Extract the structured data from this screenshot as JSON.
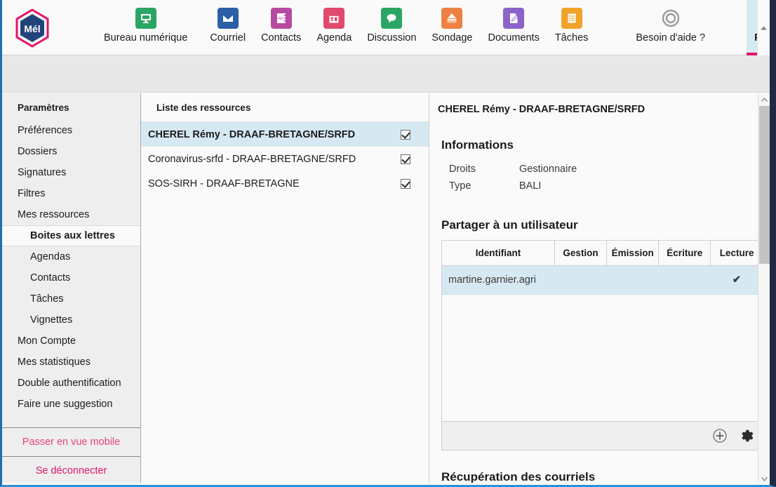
{
  "app": {
    "logo_text": "Mél",
    "accent_pink": "#e5136a",
    "accent_blue": "#d6e9f2",
    "check_green": "#6c9c33"
  },
  "toolbar": {
    "items": [
      {
        "label": "Bureau numérique",
        "icon": "monitor-icon",
        "color": "#2aa563",
        "active": false
      },
      {
        "label": "Courriel",
        "icon": "envelope-icon",
        "color": "#2c5fa8",
        "active": false
      },
      {
        "label": "Contacts",
        "icon": "addressbook-icon",
        "color": "#b64aa0",
        "active": false
      },
      {
        "label": "Agenda",
        "icon": "calendar-icon",
        "color": "#e04a6e",
        "active": false
      },
      {
        "label": "Discussion",
        "icon": "chat-bubble-icon",
        "color": "#2aa563",
        "active": false
      },
      {
        "label": "Sondage",
        "icon": "ballot-box-icon",
        "color": "#ef8043",
        "active": false
      },
      {
        "label": "Documents",
        "icon": "document-edit-icon",
        "color": "#8b63c9",
        "active": false
      },
      {
        "label": "Tâches",
        "icon": "tasklist-icon",
        "color": "#f0a32a",
        "active": false
      },
      {
        "label": "Besoin d'aide ?",
        "icon": "help-ring-icon",
        "color": "#8f8f8f",
        "active": false
      },
      {
        "label": "Paramètres",
        "icon": "gear-icon",
        "color": "#8f8f8f",
        "active": true
      }
    ]
  },
  "sidebar": {
    "title": "Paramètres",
    "items": [
      {
        "label": "Préférences",
        "sub": false,
        "selected": false
      },
      {
        "label": "Dossiers",
        "sub": false,
        "selected": false
      },
      {
        "label": "Signatures",
        "sub": false,
        "selected": false
      },
      {
        "label": "Filtres",
        "sub": false,
        "selected": false
      },
      {
        "label": "Mes ressources",
        "sub": false,
        "selected": false
      },
      {
        "label": "Boites aux lettres",
        "sub": true,
        "selected": true
      },
      {
        "label": "Agendas",
        "sub": true,
        "selected": false
      },
      {
        "label": "Contacts",
        "sub": true,
        "selected": false
      },
      {
        "label": "Tâches",
        "sub": true,
        "selected": false
      },
      {
        "label": "Vignettes",
        "sub": true,
        "selected": false
      },
      {
        "label": "Mon Compte",
        "sub": false,
        "selected": false
      },
      {
        "label": "Mes statistiques",
        "sub": false,
        "selected": false
      },
      {
        "label": "Double authentification",
        "sub": false,
        "selected": false
      },
      {
        "label": "Faire une suggestion",
        "sub": false,
        "selected": false
      }
    ],
    "mobile_view_label": "Passer en vue mobile",
    "logout_label": "Se déconnecter"
  },
  "resources": {
    "header": "Liste des ressources",
    "rows": [
      {
        "label": "CHEREL Rémy - DRAAF-BRETAGNE/SRFD",
        "checked": true,
        "selected": true
      },
      {
        "label": "Coronavirus-srfd - DRAAF-BRETAGNE/SRFD",
        "checked": true,
        "selected": false
      },
      {
        "label": "SOS-SIRH - DRAAF-BRETAGNE",
        "checked": true,
        "selected": false
      }
    ]
  },
  "detail": {
    "title": "CHEREL Rémy - DRAAF-BRETAGNE/SRFD",
    "informations_heading": "Informations",
    "info": [
      {
        "key": "Droits",
        "value": "Gestionnaire"
      },
      {
        "key": "Type",
        "value": "BALI"
      }
    ],
    "share_heading": "Partager à un utilisateur",
    "share_table": {
      "columns": [
        "Identifiant",
        "Gestion",
        "Émission",
        "Écriture",
        "Lecture"
      ],
      "rows": [
        {
          "identifiant": "martine.garnier.agri",
          "gestion": "",
          "emission": "",
          "ecriture": "",
          "lecture": "✔"
        }
      ]
    },
    "table_actions": [
      {
        "name": "add-share-button",
        "icon": "plus-circle-icon"
      },
      {
        "name": "table-settings-button",
        "icon": "gear-icon"
      }
    ],
    "recup_heading": "Récupération des courriels"
  }
}
